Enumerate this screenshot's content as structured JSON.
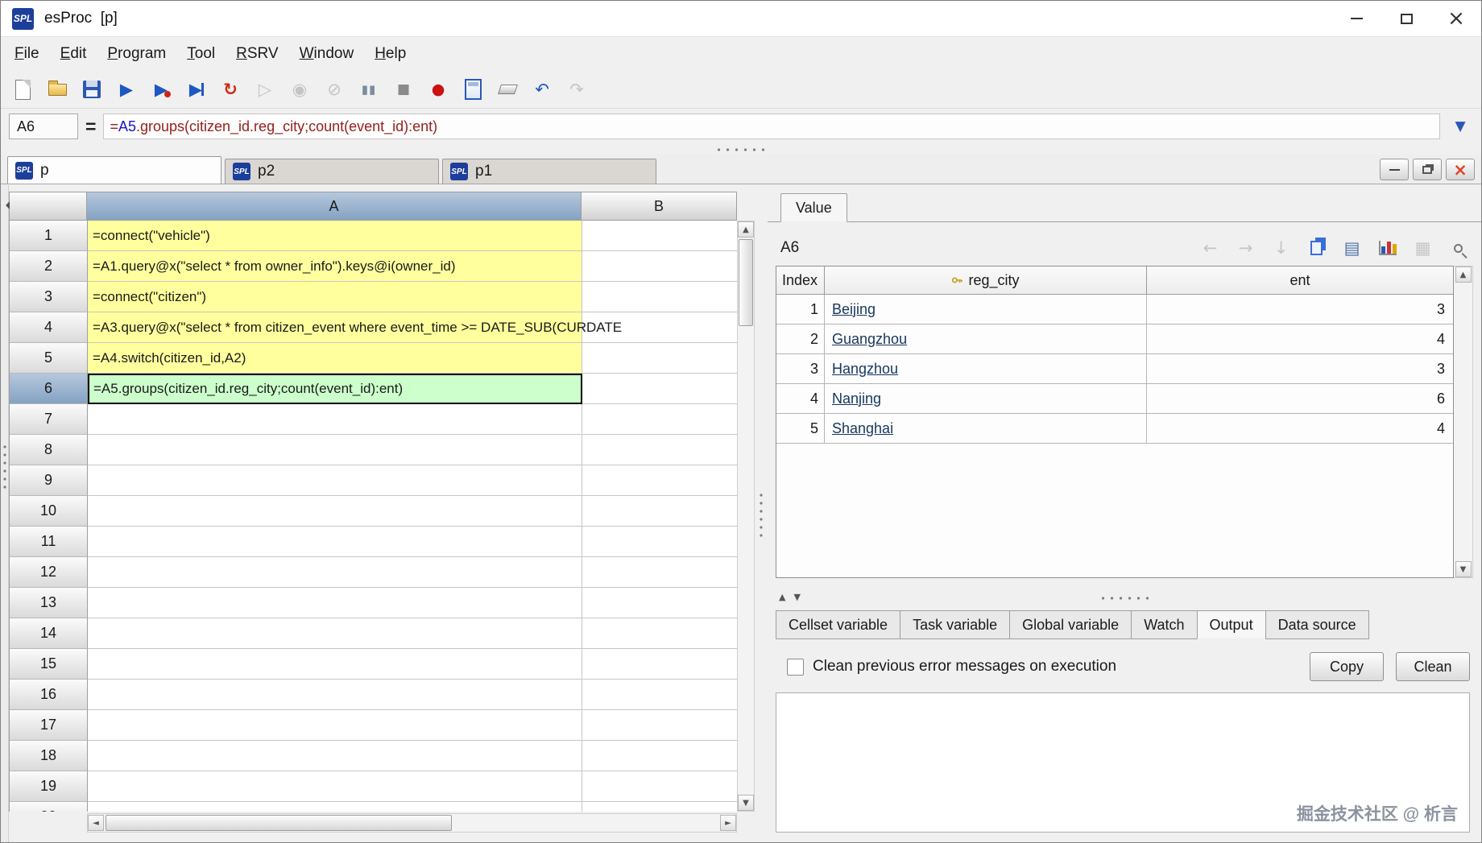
{
  "window": {
    "title": "esProc  [p]",
    "icon_text": "SPL"
  },
  "menubar": {
    "items": [
      {
        "hot": "F",
        "rest": "ile"
      },
      {
        "hot": "E",
        "rest": "dit"
      },
      {
        "hot": "P",
        "rest": "rogram"
      },
      {
        "hot": "T",
        "rest": "ool"
      },
      {
        "hot": "R",
        "rest": "SRV"
      },
      {
        "hot": "W",
        "rest": "indow"
      },
      {
        "hot": "H",
        "rest": "elp"
      }
    ]
  },
  "formula_bar": {
    "cell_ref": "A6",
    "equals": "=",
    "prefix": "=",
    "ref": "A5",
    "body": ".groups(citizen_id.reg_city;count(event_id):ent)"
  },
  "sheet_tabs": [
    {
      "label": "p",
      "cls": "active"
    },
    {
      "label": "p2",
      "cls": ""
    },
    {
      "label": "p1",
      "cls": ""
    }
  ],
  "grid": {
    "col_headers": [
      "A",
      "B"
    ],
    "rows": [
      {
        "n": "1",
        "a": "=connect(\"vehicle\")",
        "cls": "yellow"
      },
      {
        "n": "2",
        "a": "=A1.query@x(\"select * from owner_info\").keys@i(owner_id)",
        "cls": "yellow"
      },
      {
        "n": "3",
        "a": "=connect(\"citizen\")",
        "cls": "yellow"
      },
      {
        "n": "4",
        "a": "=A3.query@x(\"select * from citizen_event where event_time >= DATE_SUB(CURDATE",
        "cls": "yellow"
      },
      {
        "n": "5",
        "a": "=A4.switch(citizen_id,A2)",
        "cls": "yellow"
      },
      {
        "n": "6",
        "a": "=A5.groups(citizen_id.reg_city;count(event_id):ent)",
        "cls": "selected"
      },
      {
        "n": "7",
        "a": "",
        "cls": ""
      },
      {
        "n": "8",
        "a": "",
        "cls": ""
      },
      {
        "n": "9",
        "a": "",
        "cls": ""
      },
      {
        "n": "10",
        "a": "",
        "cls": ""
      },
      {
        "n": "11",
        "a": "",
        "cls": ""
      },
      {
        "n": "12",
        "a": "",
        "cls": ""
      },
      {
        "n": "13",
        "a": "",
        "cls": ""
      },
      {
        "n": "14",
        "a": "",
        "cls": ""
      },
      {
        "n": "15",
        "a": "",
        "cls": ""
      },
      {
        "n": "16",
        "a": "",
        "cls": ""
      },
      {
        "n": "17",
        "a": "",
        "cls": ""
      },
      {
        "n": "18",
        "a": "",
        "cls": ""
      },
      {
        "n": "19",
        "a": "",
        "cls": ""
      },
      {
        "n": "20",
        "a": "",
        "cls": ""
      }
    ]
  },
  "value_panel": {
    "tab_label": "Value",
    "cell_ref": "A6",
    "table": {
      "headers": {
        "index": "Index",
        "reg_city": "reg_city",
        "ent": "ent"
      },
      "rows": [
        {
          "index": "1",
          "city": "Beijing",
          "ent": "3"
        },
        {
          "index": "2",
          "city": "Guangzhou",
          "ent": "4"
        },
        {
          "index": "3",
          "city": "Hangzhou",
          "ent": "3"
        },
        {
          "index": "4",
          "city": "Nanjing",
          "ent": "6"
        },
        {
          "index": "5",
          "city": "Shanghai",
          "ent": "4"
        }
      ]
    }
  },
  "bottom_panel": {
    "tabs": [
      {
        "label": "Cellset variable",
        "cls": ""
      },
      {
        "label": "Task variable",
        "cls": ""
      },
      {
        "label": "Global variable",
        "cls": ""
      },
      {
        "label": "Watch",
        "cls": ""
      },
      {
        "label": "Output",
        "cls": "active"
      },
      {
        "label": "Data source",
        "cls": ""
      }
    ],
    "checkbox_label": "Clean previous error messages on execution",
    "copy_button": "Copy",
    "clean_button": "Clean",
    "watermark": "掘金技术社区 @ 析言"
  },
  "icons": {
    "run": "▶",
    "pause": "▮▮",
    "stop": "■",
    "record": "●",
    "recalc": "↻",
    "undo": "↶",
    "redo": "↷",
    "expand": "▼",
    "back": "←",
    "forward": "→",
    "export": "↓",
    "form": "▤",
    "grid": "▦",
    "close": "×",
    "up": "▲",
    "down": "▼",
    "left": "◄",
    "right": "►",
    "disabled_a": "▷",
    "disabled_b": "◉",
    "disabled_c": "⊘"
  },
  "colors": {
    "accent_blue": "#1d57c4",
    "formula_red": "#96201c",
    "ref_blue": "#1414cc",
    "cell_yellow": "#ffff9e",
    "cell_green": "#ccffcc",
    "header_selected": "#84a2c2",
    "record_red": "#cc1111"
  }
}
